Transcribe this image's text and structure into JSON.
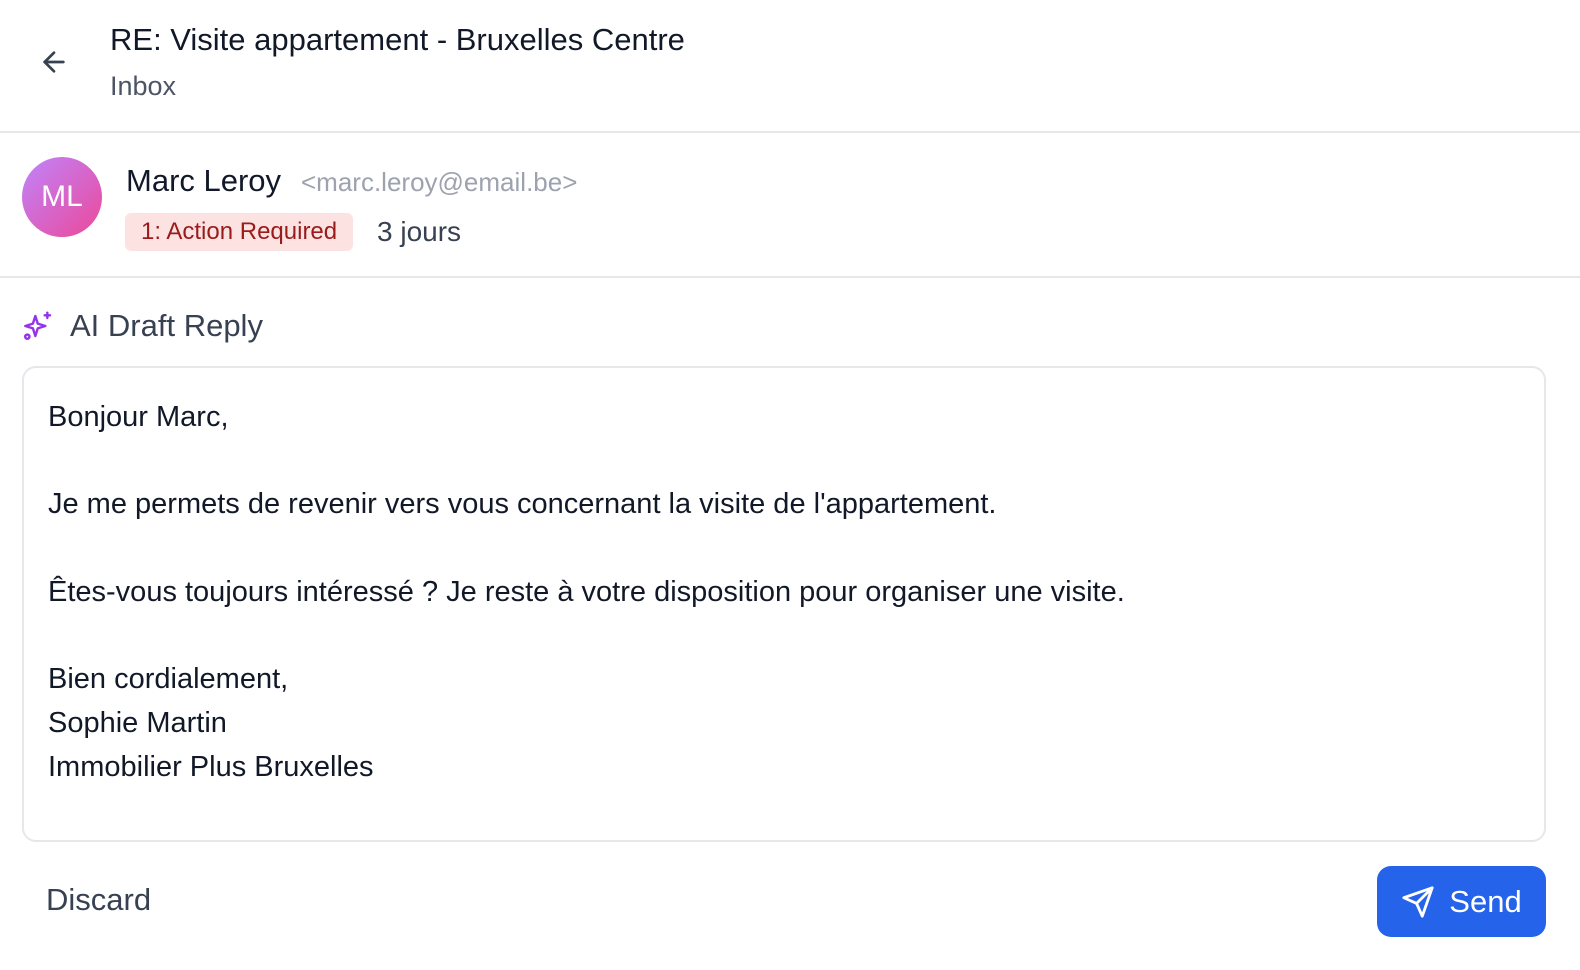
{
  "header": {
    "title": "RE: Visite appartement - Bruxelles Centre",
    "folder": "Inbox",
    "back_icon": "arrow-left-icon"
  },
  "sender": {
    "initials": "ML",
    "name": "Marc Leroy",
    "email": "<marc.leroy@email.be>",
    "badge": "1: Action Required",
    "age": "3 jours",
    "avatar_gradient": [
      "#c084fc",
      "#ec4899"
    ],
    "badge_bg": "#fde2e2",
    "badge_color": "#991b1b"
  },
  "ai_draft": {
    "icon": "sparkles-icon",
    "label": "AI Draft Reply",
    "body": "Bonjour Marc,\n\nJe me permets de revenir vers vous concernant la visite de l'appartement.\n\nÊtes-vous toujours intéressé ? Je reste à votre disposition pour organiser une visite.\n\nBien cordialement,\nSophie Martin\nImmobilier Plus Bruxelles"
  },
  "actions": {
    "discard_label": "Discard",
    "send_label": "Send",
    "send_icon": "paper-plane-icon",
    "accent": "#2563eb"
  }
}
